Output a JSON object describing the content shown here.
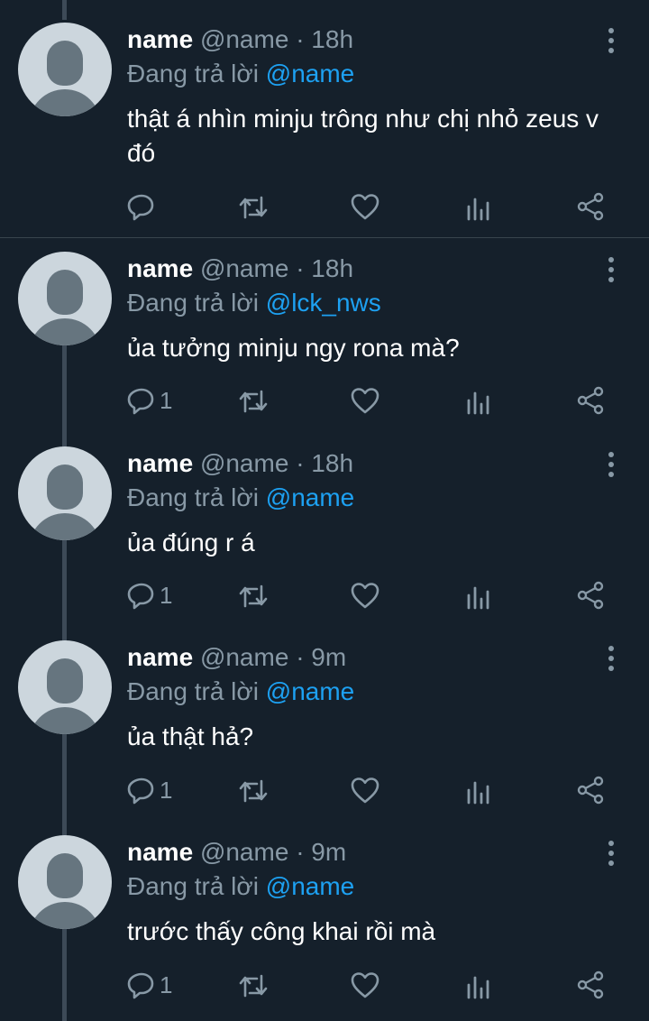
{
  "reply_prefix": "Đang trả lời",
  "tweets": [
    {
      "name": "name",
      "handle": "@name",
      "separator": "·",
      "time": "18h",
      "reply_to": "@name",
      "text": "thật á nhìn minju trông như chị nhỏ zeus v đó",
      "reply_count": ""
    },
    {
      "name": "name",
      "handle": "@name",
      "separator": "·",
      "time": "18h",
      "reply_to": "@lck_nws",
      "text": "ủa tưởng minju ngy rona mà?",
      "reply_count": "1"
    },
    {
      "name": "name",
      "handle": "@name",
      "separator": "·",
      "time": "18h",
      "reply_to": "@name",
      "text": "ủa đúng r á",
      "reply_count": "1"
    },
    {
      "name": "name",
      "handle": "@name",
      "separator": "·",
      "time": "9m",
      "reply_to": "@name",
      "text": "ủa thật hả?",
      "reply_count": "1"
    },
    {
      "name": "name",
      "handle": "@name",
      "separator": "·",
      "time": "9m",
      "reply_to": "@name",
      "text": "trước thấy công khai rồi mà",
      "reply_count": "1"
    }
  ],
  "icons": {
    "reply": "reply-icon",
    "retweet": "retweet-icon",
    "like": "heart-icon",
    "analytics": "analytics-icon",
    "share": "share-icon",
    "more": "more-vertical-icon"
  },
  "colors": {
    "background": "#15202b",
    "divider": "#38444d",
    "text_primary": "#ffffff",
    "text_secondary": "#8899a6",
    "link": "#1da1f2",
    "thread_line": "#3d4a57"
  }
}
